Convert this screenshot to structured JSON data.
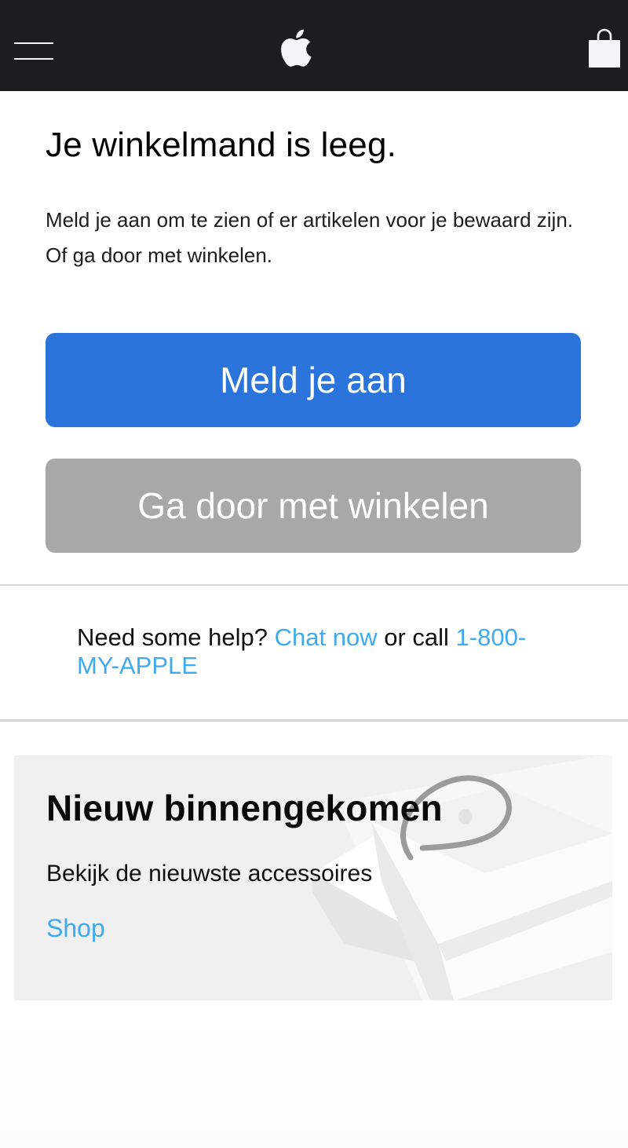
{
  "header": {
    "menu_icon": "hamburger-menu-icon",
    "logo_icon": "apple-logo-icon",
    "bag_icon": "shopping-bag-icon",
    "background_color": "#1d1d1f"
  },
  "cart": {
    "title": "Je winkelmand is leeg.",
    "message": "Meld je aan om te zien of er artikelen voor je bewaard zijn. Of ga door met winkelen.",
    "signin_button": "Meld je aan",
    "continue_button": "Ga door met winkelen",
    "primary_color": "#2a74db",
    "secondary_color": "#a8a8a8"
  },
  "help": {
    "prefix": "Need some help?",
    "chat_link": "Chat now",
    "middle": "or call",
    "phone_link": "1-800-MY-APPLE",
    "link_color": "#3eaaf0"
  },
  "promo": {
    "title": "Nieuw binnengekomen",
    "subtitle": "Bekijk de nieuwste accessoires",
    "link": "Shop",
    "image": "shopping-bag-image"
  }
}
